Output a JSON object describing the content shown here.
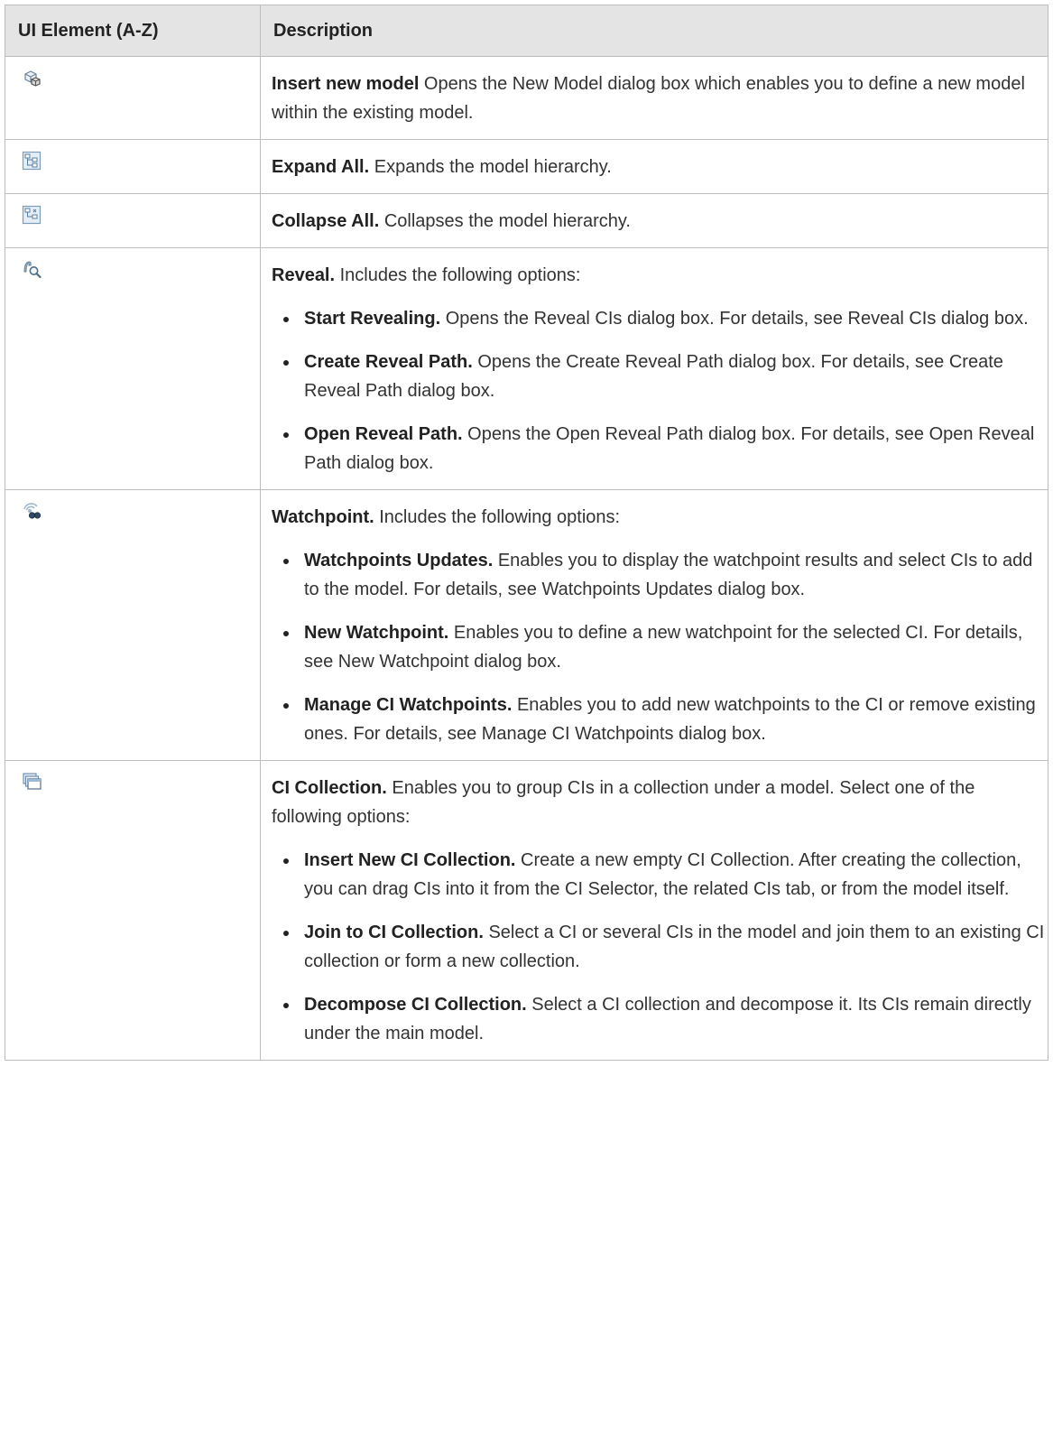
{
  "table": {
    "header": {
      "element": "UI Element (A-Z)",
      "description": "Description"
    },
    "rows": [
      {
        "icon": "insert-model-icon",
        "title": "Insert new model",
        "text": " Opens the New Model dialog box which enables you to define a new model within the existing model."
      },
      {
        "icon": "expand-all-icon",
        "title": "Expand All.",
        "text": " Expands the model hierarchy."
      },
      {
        "icon": "collapse-all-icon",
        "title": "Collapse All.",
        "text": " Collapses the model hierarchy."
      },
      {
        "icon": "reveal-icon",
        "title": "Reveal.",
        "text": " Includes the following options:",
        "options": [
          {
            "title": "Start Revealing.",
            "text": " Opens the Reveal CIs dialog box. For details, see Reveal CIs dialog box."
          },
          {
            "title": "Create Reveal Path.",
            "text": " Opens the Create Reveal Path dialog box. For details, see Create Reveal Path dialog box."
          },
          {
            "title": "Open Reveal Path.",
            "text": " Opens the Open Reveal Path dialog box. For details, see Open Reveal Path dialog box."
          }
        ]
      },
      {
        "icon": "watchpoint-icon",
        "title": "Watchpoint.",
        "text": " Includes the following options:",
        "options": [
          {
            "title": "Watchpoints Updates.",
            "text": " Enables you to display the watchpoint results and select CIs to add to the model. For details, see Watchpoints Updates dialog box."
          },
          {
            "title": "New Watchpoint.",
            "text": " Enables you to define a new watchpoint for the selected CI. For details, see New Watchpoint dialog box."
          },
          {
            "title": "Manage CI Watchpoints.",
            "text": " Enables you to add new watchpoints to the CI or remove existing ones. For details, see Manage CI Watchpoints dialog box."
          }
        ]
      },
      {
        "icon": "ci-collection-icon",
        "title": "CI Collection.",
        "text": " Enables you to group CIs in a collection under a model. Select one of the following options:",
        "options": [
          {
            "title": "Insert New CI Collection.",
            "text": " Create a new empty CI Collection. After creating the collection, you can drag CIs into it from the CI Selector, the related CIs tab, or from the model itself."
          },
          {
            "title": "Join to CI Collection.",
            "text": " Select a CI or several CIs in the model and join them to an existing CI collection or form a new collection."
          },
          {
            "title": "Decompose CI Collection.",
            "text": " Select a CI collection and decompose it. Its CIs remain directly under the main model."
          }
        ]
      }
    ]
  }
}
